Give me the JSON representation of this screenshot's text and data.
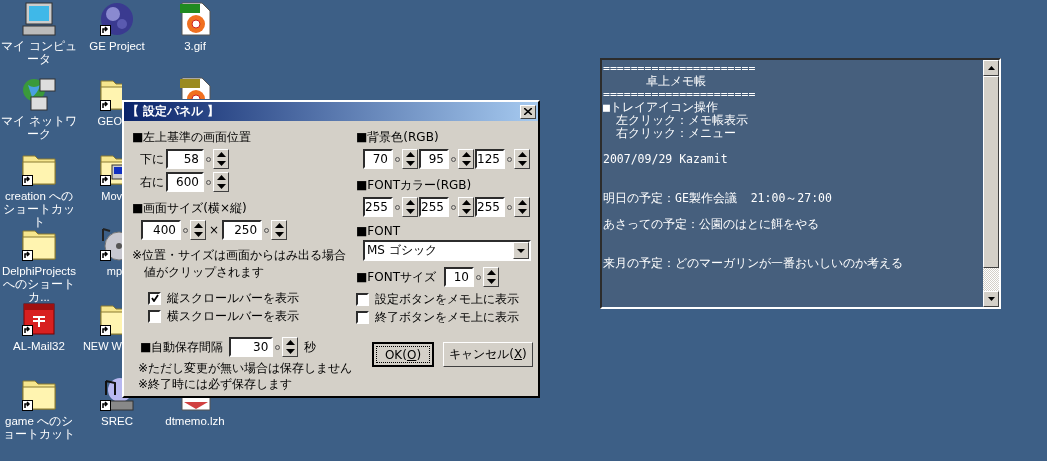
{
  "desktop": {
    "icons": [
      {
        "kind": "computer",
        "label": "マイ コンピュータ",
        "shortcut": false
      },
      {
        "kind": "network",
        "label": "マイ ネットワーク",
        "shortcut": false
      },
      {
        "kind": "folder",
        "label": "creation へのショートカット",
        "shortcut": true
      },
      {
        "kind": "folder",
        "label": "DelphiProjects へのショートカ...",
        "shortcut": true
      },
      {
        "kind": "mailbox",
        "label": "AL-Mail32",
        "shortcut": true
      },
      {
        "kind": "folder",
        "label": "game へのショートカット",
        "shortcut": true
      },
      {
        "kind": "globe",
        "label": "GE Project",
        "shortcut": true
      },
      {
        "kind": "folder",
        "label": "GEO",
        "shortcut": true
      },
      {
        "kind": "app-folder",
        "label": "Mov",
        "shortcut": true
      },
      {
        "kind": "disc",
        "label": "mp",
        "shortcut": true
      },
      {
        "kind": "folder",
        "label": "NEW W",
        "shortcut": true
      },
      {
        "kind": "music",
        "label": "SREC",
        "shortcut": true
      },
      {
        "kind": "gif",
        "label": "3.gif",
        "shortcut": false
      },
      {
        "kind": "jpg",
        "shortcut": false
      },
      {
        "kind": "archive",
        "label": "dtmemo.lzh",
        "shortcut": false
      }
    ]
  },
  "dialog": {
    "title": "【 設定パネル 】",
    "position": {
      "heading": "■左上基準の画面位置",
      "fields": [
        {
          "label": "下に",
          "value": "58"
        },
        {
          "label": "右に",
          "value": "600"
        }
      ]
    },
    "size": {
      "heading": "■画面サイズ(横×縦)",
      "values": [
        "400",
        "250"
      ],
      "separator": "×"
    },
    "note": [
      "※位置・サイズは画面からはみ出る場合",
      "値がクリップされます"
    ],
    "left_checkboxes": [
      {
        "label": "縦スクロールバーを表示",
        "checked": true
      },
      {
        "label": "横スクロールバーを表示",
        "checked": false
      }
    ],
    "autosave": {
      "heading": "■自動保存間隔",
      "value": "30",
      "unit": "秒",
      "notes": [
        "※ただし変更が無い場合は保存しません",
        "※終了時には必ず保存します"
      ]
    },
    "background_color": {
      "heading": "■背景色(RGB)",
      "values": [
        "70",
        "95",
        "125"
      ]
    },
    "font_color": {
      "heading": "■FONTカラー(RGB)",
      "values": [
        "255",
        "255",
        "255"
      ]
    },
    "font": {
      "heading": "■FONT",
      "value": "MS ゴシック"
    },
    "font_size": {
      "heading": "■FONTサイズ",
      "value": "10"
    },
    "right_checkboxes": [
      {
        "label": "設定ボタンをメモ上に表示",
        "checked": false
      },
      {
        "label": "終了ボタンをメモ上に表示",
        "checked": false
      }
    ],
    "buttons": [
      {
        "before": "OK(",
        "mnemonic": "O",
        "after": ")",
        "default": true
      },
      {
        "before": "キャンセル(",
        "mnemonic": "X",
        "after": ")",
        "default": false
      }
    ]
  },
  "memo": {
    "lines": [
      {
        "kind": "rule",
        "text": "======================"
      },
      {
        "kind": "title",
        "text": "卓上メモ帳"
      },
      {
        "kind": "rule",
        "text": "======================"
      },
      {
        "kind": "text",
        "text": "■トレイアイコン操作"
      },
      {
        "kind": "item",
        "text": "左クリック：メモ帳表示"
      },
      {
        "kind": "item",
        "text": "右クリック：メニュー"
      },
      {
        "kind": "text",
        "text": "2007/09/29 Kazamit"
      },
      {
        "kind": "text",
        "text": "明日の予定：GE製作会議  21:00～27:00"
      },
      {
        "kind": "text",
        "text": "あさっての予定：公園のはとに餌をやる"
      },
      {
        "kind": "text",
        "text": "来月の予定：どのマーガリンが一番おいしいのか考える"
      }
    ]
  }
}
